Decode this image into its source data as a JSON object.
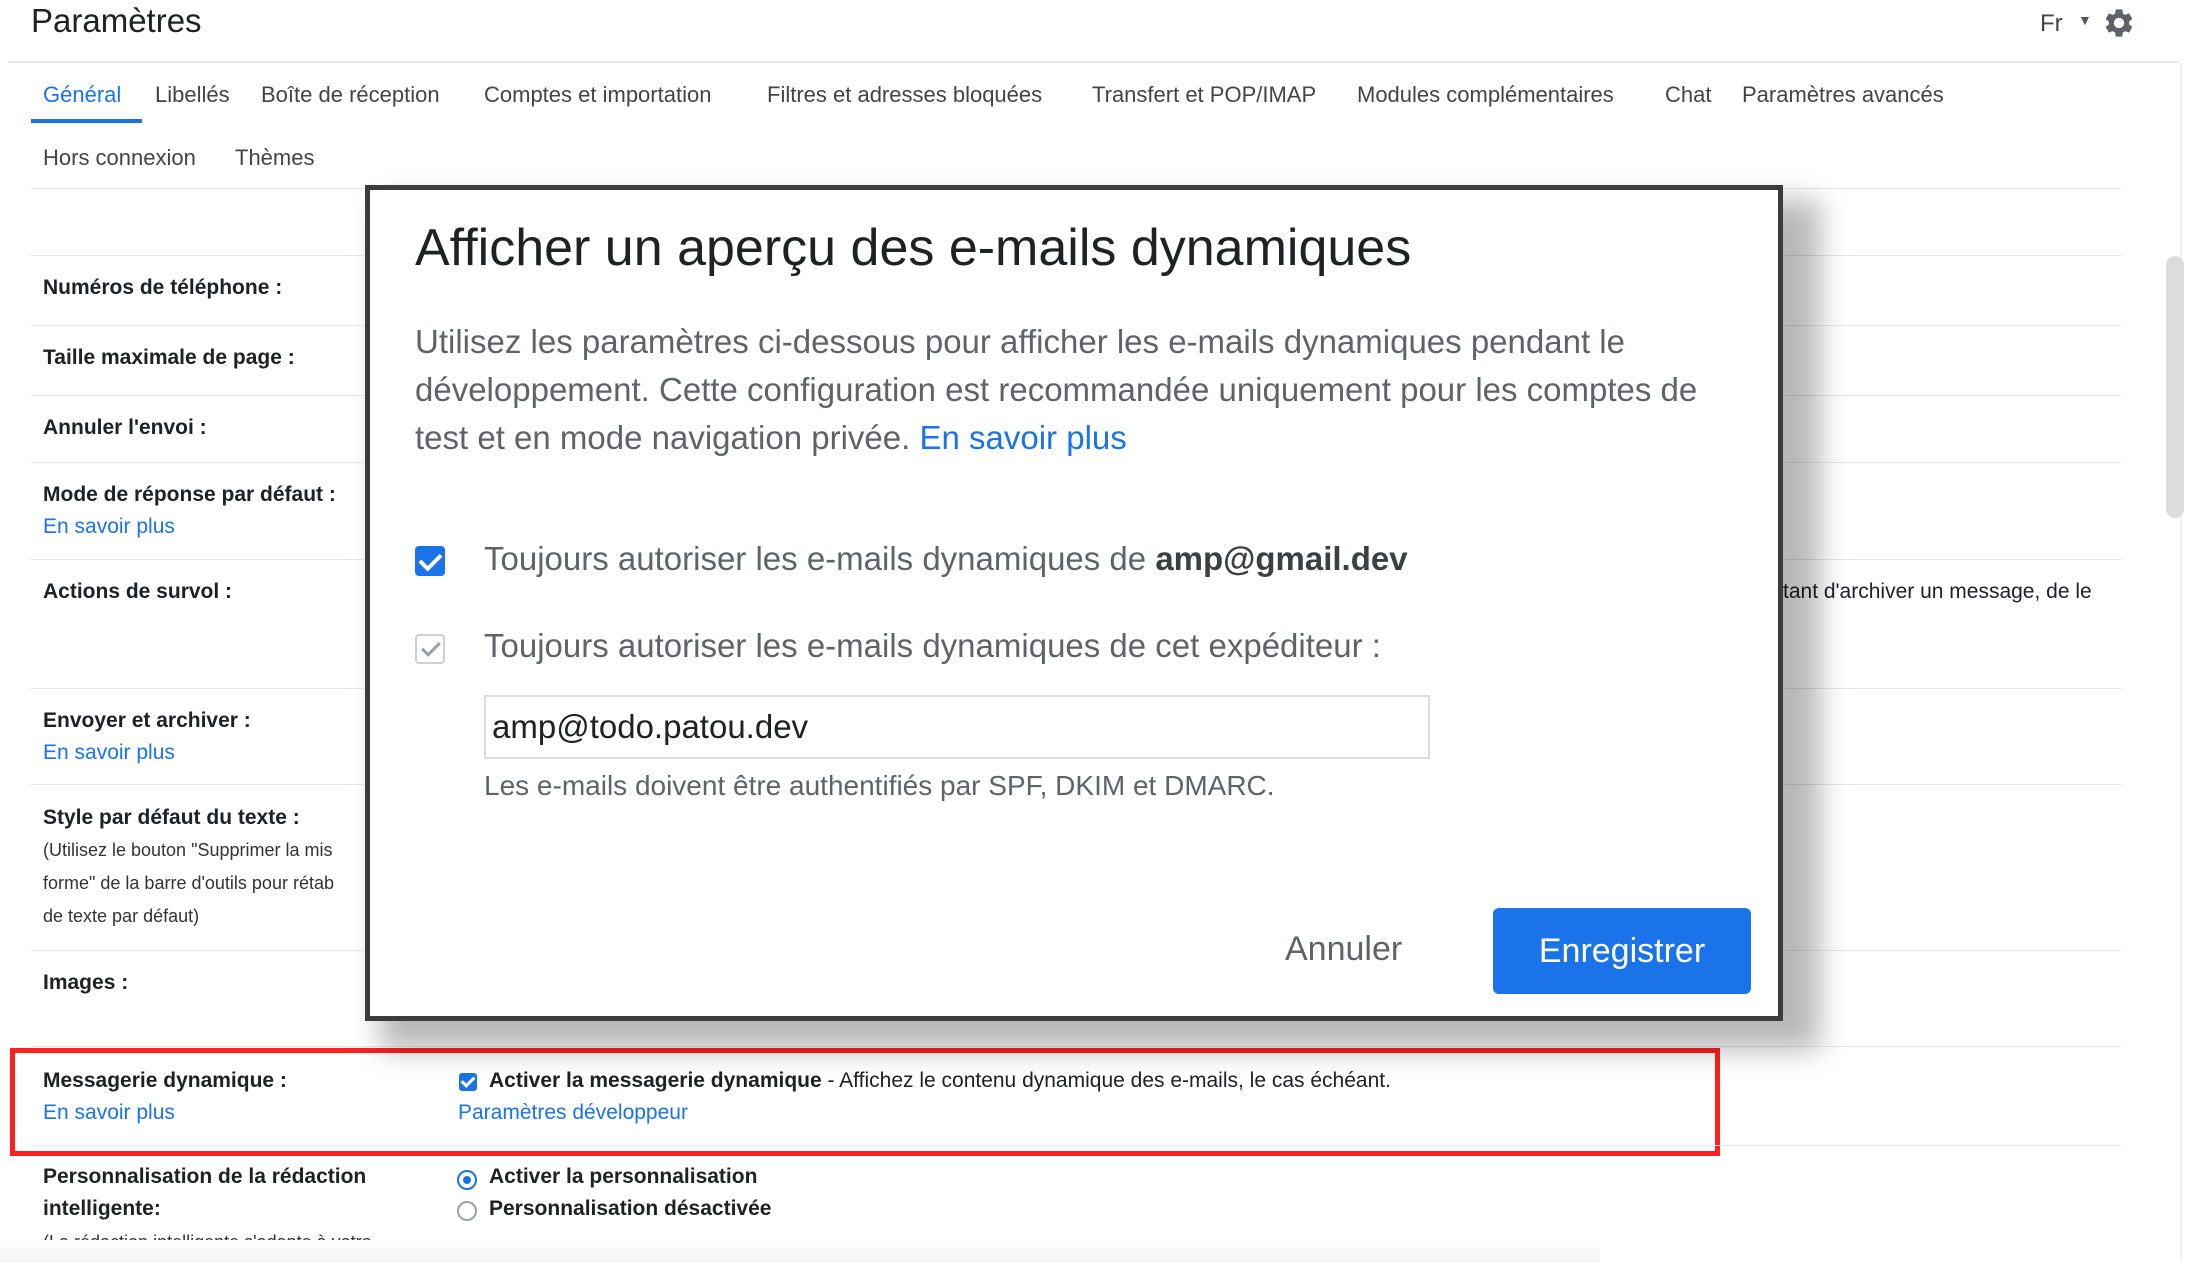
{
  "header": {
    "title": "Paramètres",
    "language": "Fr"
  },
  "tabs": [
    {
      "label": "Général"
    },
    {
      "label": "Libellés"
    },
    {
      "label": "Boîte de réception"
    },
    {
      "label": "Comptes et importation"
    },
    {
      "label": "Filtres et adresses bloquées"
    },
    {
      "label": "Transfert et POP/IMAP"
    },
    {
      "label": "Modules complémentaires"
    },
    {
      "label": "Chat"
    },
    {
      "label": "Paramètres avancés"
    },
    {
      "label": "Hors connexion"
    },
    {
      "label": "Thèmes"
    }
  ],
  "settings": {
    "phone": {
      "label": "Numéros de téléphone :"
    },
    "page_size": {
      "label": "Taille maximale de page :"
    },
    "undo_send": {
      "label": "Annuler l'envoi :"
    },
    "reply_mode": {
      "label": "Mode de réponse par défaut :",
      "link": "En savoir plus"
    },
    "hover": {
      "label": "Actions de survol :",
      "text": "tant d'archiver un message, de le"
    },
    "send_archive": {
      "label": "Envoyer et archiver :",
      "link": "En savoir plus"
    },
    "text_style": {
      "label": "Style par défaut du texte :",
      "note1": "(Utilisez le bouton \"Supprimer la mis",
      "note2": "forme\" de la barre d'outils pour rétab",
      "note3": "de texte par défaut)"
    },
    "images": {
      "label": "Images :"
    },
    "dynamic": {
      "label": "Messagerie dynamique :",
      "link": "En savoir plus",
      "option_bold": "Activer la messagerie dynamique",
      "option_rest": " - Affichez le contenu dynamique des e-mails, le cas échéant.",
      "dev_link": "Paramètres développeur"
    },
    "smart_compose": {
      "label1": "Personnalisation de la rédaction",
      "label2": "intelligente:",
      "note": "(La rédaction intelligente s'adapte à votre",
      "opt_on": "Activer la personnalisation",
      "opt_off": "Personnalisation désactivée"
    }
  },
  "dialog": {
    "title": "Afficher un aperçu des e-mails dynamiques",
    "description": "Utilisez les paramètres ci-dessous pour afficher les e-mails dynamiques pendant le développement. Cette configuration est recommandée uniquement pour les comptes de test et en mode navigation privée. ",
    "learn_more": "En savoir plus",
    "option1_text": "Toujours autoriser les e-mails dynamiques de ",
    "option1_email": "amp@gmail.dev",
    "option2_text": "Toujours autoriser les e-mails dynamiques de cet expéditeur :",
    "sender_value": "amp@todo.patou.dev",
    "hint": "Les e-mails doivent être authentifiés par SPF, DKIM et DMARC.",
    "cancel": "Annuler",
    "save": "Enregistrer"
  }
}
